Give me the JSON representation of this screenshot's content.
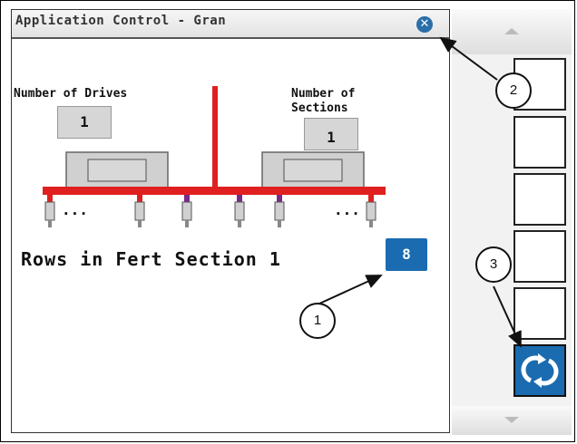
{
  "window": {
    "title": "Application Control - Gran"
  },
  "drives": {
    "label": "Number of Drives",
    "value": "1"
  },
  "sections": {
    "label_line1": "Number of",
    "label_line2": "Sections",
    "value": "1"
  },
  "diagram": {
    "ellipsis_left": "...",
    "ellipsis_right": "...",
    "bar_color": "#e02020"
  },
  "rows": {
    "label": "Rows in Fert Section 1",
    "value": "8"
  },
  "callouts": [
    "1",
    "2",
    "3"
  ],
  "icons": {
    "close": "close-icon",
    "refresh": "refresh-icon",
    "up": "chevron-up-icon",
    "down": "chevron-down-icon"
  }
}
